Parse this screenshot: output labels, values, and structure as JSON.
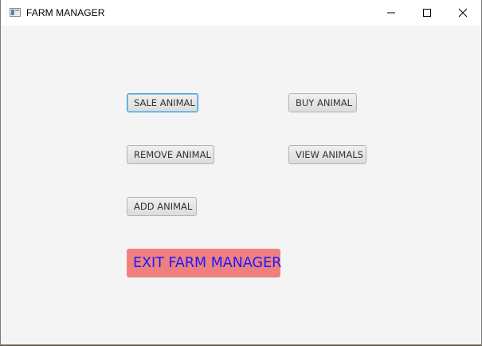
{
  "window": {
    "title": "FARM MANAGER"
  },
  "buttons": {
    "sale_animal": "SALE ANIMAL",
    "buy_animal": "BUY ANIMAL",
    "remove_animal": "REMOVE ANIMAL",
    "view_animals": "VIEW ANIMALS",
    "add_animal": "ADD ANIMAL",
    "exit": "EXIT FARM MANAGER"
  },
  "colors": {
    "exit_background": "#f08080",
    "exit_text": "#1a1aff",
    "focus_border": "#3a9ed8"
  }
}
